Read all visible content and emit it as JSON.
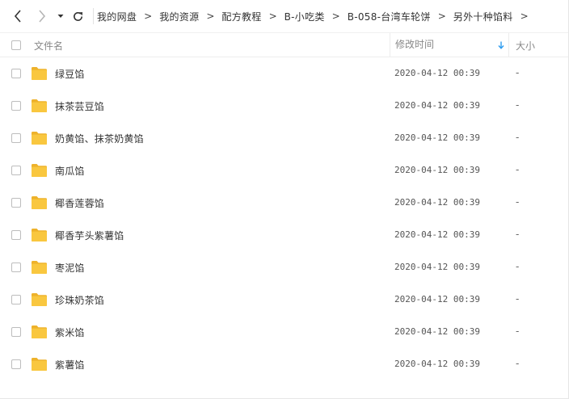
{
  "nav": {
    "back_icon": "chevron-left-icon",
    "forward_icon": "chevron-right-icon",
    "dropdown_icon": "caret-down-icon",
    "refresh_icon": "refresh-icon"
  },
  "breadcrumb": {
    "items": [
      "我的网盘",
      "我的资源",
      "配方教程",
      "B-小吃类",
      "B-058-台湾车轮饼",
      "另外十种馅料"
    ],
    "separator": ">"
  },
  "columns": {
    "name": "文件名",
    "modified": "修改时间",
    "size": "大小"
  },
  "files": [
    {
      "name": "绿豆馅",
      "modified": "2020-04-12 00:39",
      "size": "-"
    },
    {
      "name": "抹茶芸豆馅",
      "modified": "2020-04-12 00:39",
      "size": "-"
    },
    {
      "name": "奶黄馅、抹茶奶黄馅",
      "modified": "2020-04-12 00:39",
      "size": "-"
    },
    {
      "name": "南瓜馅",
      "modified": "2020-04-12 00:39",
      "size": "-"
    },
    {
      "name": "椰香莲蓉馅",
      "modified": "2020-04-12 00:39",
      "size": "-"
    },
    {
      "name": "椰香芋头紫薯馅",
      "modified": "2020-04-12 00:39",
      "size": "-"
    },
    {
      "name": "枣泥馅",
      "modified": "2020-04-12 00:39",
      "size": "-"
    },
    {
      "name": "珍珠奶茶馅",
      "modified": "2020-04-12 00:39",
      "size": "-"
    },
    {
      "name": "紫米馅",
      "modified": "2020-04-12 00:39",
      "size": "-"
    },
    {
      "name": "紫薯馅",
      "modified": "2020-04-12 00:39",
      "size": "-"
    }
  ],
  "colors": {
    "folder": "#f9c73f",
    "folder_dark": "#eeb22b",
    "sort_arrow": "#2d9cf0",
    "checkbox_border": "#bdbdbd"
  }
}
